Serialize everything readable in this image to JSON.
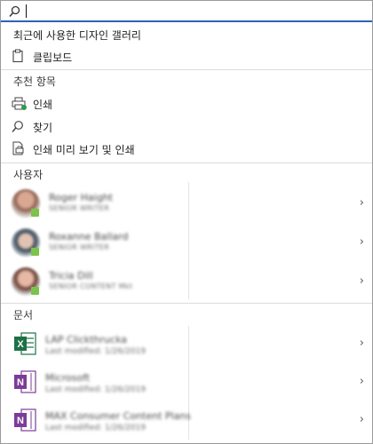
{
  "search": {
    "value": ""
  },
  "recent": {
    "header": "최근에 사용한 디자인 갤러리",
    "items": [
      {
        "label": "클립보드",
        "icon": "clipboard-icon"
      }
    ]
  },
  "recommended": {
    "header": "추천 항목",
    "items": [
      {
        "label": "인쇄",
        "icon": "print-icon"
      },
      {
        "label": "찾기",
        "icon": "search-icon"
      },
      {
        "label": "인쇄 미리 보기 및 인쇄",
        "icon": "print-preview-icon"
      }
    ]
  },
  "people": {
    "header": "사용자",
    "items": [
      {
        "name": "Roger Haight",
        "title": "SENIOR WRITER"
      },
      {
        "name": "Roxanne Ballard",
        "title": "SENIOR WRITER"
      },
      {
        "name": "Tricia Dill",
        "title": "SENIOR CONTENT Mkt"
      }
    ]
  },
  "documents": {
    "header": "문서",
    "items": [
      {
        "title": "LAP Clickthrucka",
        "modified": "Last modified: 1/26/2019",
        "app": "Excel",
        "icon": "excel-icon"
      },
      {
        "title": "Microsoft",
        "modified": "Last modified: 1/26/2019",
        "app": "OneNote",
        "icon": "onenote-icon"
      },
      {
        "title": "MAX Consumer Content Plans",
        "modified": "Last modified: 1/26/2019",
        "app": "OneNote",
        "icon": "onenote-icon"
      }
    ]
  },
  "colors": {
    "accent": "#2f62b7",
    "presence": "#7bc34a",
    "excel": "#1e7145",
    "onenote": "#7d3c98"
  }
}
